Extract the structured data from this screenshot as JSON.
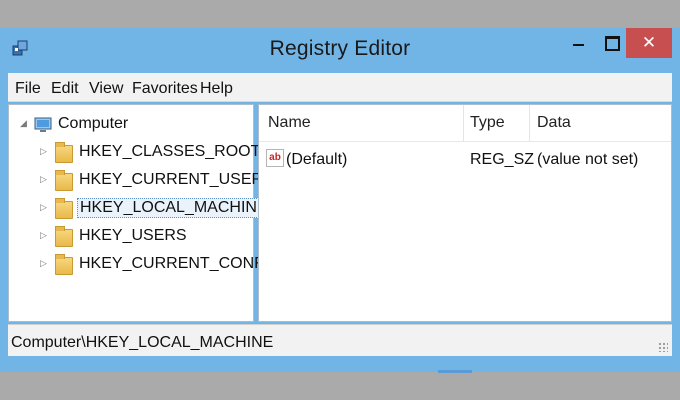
{
  "window": {
    "title": "Registry Editor",
    "close_label": "✕"
  },
  "menu": {
    "items": [
      {
        "label": "File"
      },
      {
        "label": "Edit"
      },
      {
        "label": "View"
      },
      {
        "label": "Favorites"
      },
      {
        "label": "Help"
      }
    ]
  },
  "tree": {
    "root": {
      "label": "Computer",
      "icon": "computer-icon",
      "expanded": true
    },
    "nodes": [
      {
        "label": "HKEY_CLASSES_ROOT",
        "selected": false
      },
      {
        "label": "HKEY_CURRENT_USER",
        "selected": false
      },
      {
        "label": "HKEY_LOCAL_MACHINE",
        "selected": true
      },
      {
        "label": "HKEY_USERS",
        "selected": false
      },
      {
        "label": "HKEY_CURRENT_CONFIG",
        "selected": false
      }
    ]
  },
  "list": {
    "columns": [
      "Name",
      "Type",
      "Data"
    ],
    "rows": [
      {
        "icon": "string-value-icon",
        "icon_text": "ab",
        "name": "(Default)",
        "type": "REG_SZ",
        "data": "(value not set)"
      }
    ]
  },
  "status": {
    "path": "Computer\\HKEY_LOCAL_MACHINE"
  },
  "colors": {
    "titlebar": "#71b5e6",
    "close_button": "#c74f4f",
    "selection_border": "#5a8fc8"
  }
}
